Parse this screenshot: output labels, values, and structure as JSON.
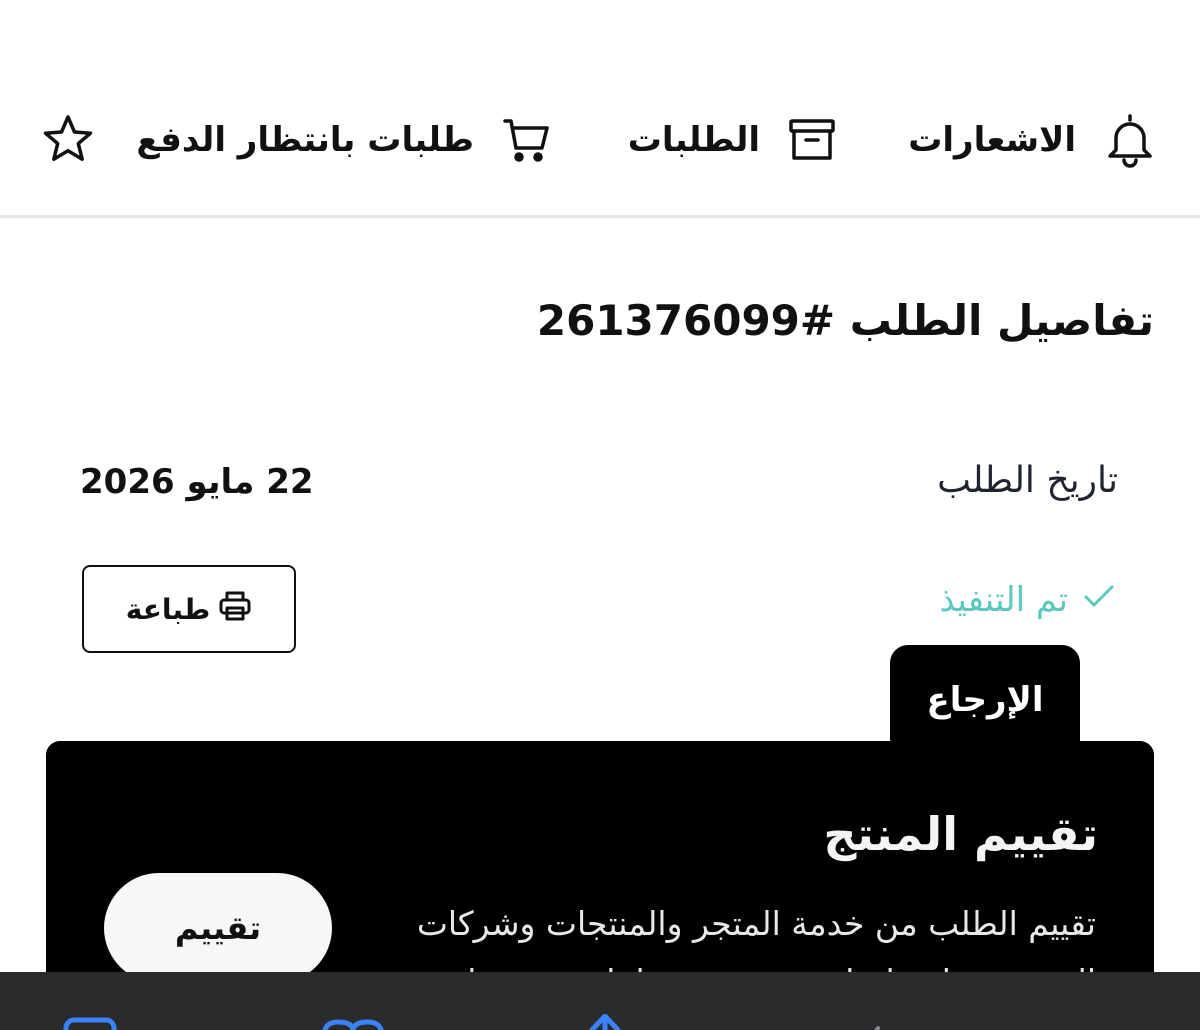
{
  "nav": {
    "notifications_label": "الاشعارات",
    "orders_label": "الطلبات",
    "pending_payment_label": "طلبات بانتظار الدفع"
  },
  "order": {
    "title": "تفاصيل الطلب #261376099",
    "date_label": "تاريخ الطلب",
    "date_value": "22 مايو 2026",
    "status": "تم التنفيذ",
    "print_label": "طباعة",
    "return_tab_label": "الإرجاع"
  },
  "review": {
    "title": "تقييم المنتج",
    "description": "تقييم الطلب من خدمة المتجر والمنتجات وشركات الشحن يساعدنا على تحسين خدماتنا وتقديم ما",
    "button_label": "تقييم"
  },
  "colors": {
    "status_green": "#5cc8be",
    "card_bg": "#000000",
    "toolbar_bg": "#2b2b2d",
    "toolbar_icon": "#3b82f6"
  },
  "icons": {
    "notifications": "bell-icon",
    "orders": "archive-box-icon",
    "pending_payment": "cart-icon",
    "favorites": "star-icon",
    "print": "printer-icon",
    "status": "check-icon"
  }
}
